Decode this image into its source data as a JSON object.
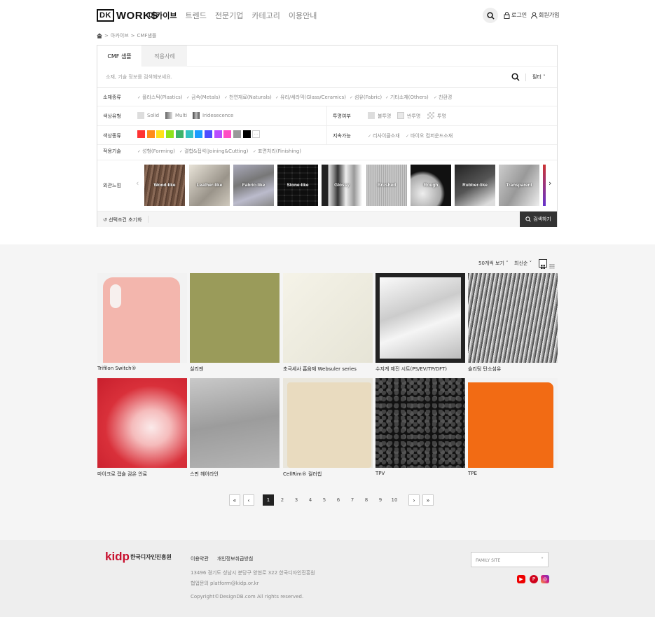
{
  "header": {
    "logo_mark": "DK",
    "logo_text": "WORKS",
    "nav": [
      "아카이브",
      "트렌드",
      "전문기업",
      "카테고리",
      "이용안내"
    ],
    "login": "로그인",
    "signup": "회원가입"
  },
  "breadcrumb": {
    "level1": "아카이브",
    "level2": "CMF샘플"
  },
  "tabs": [
    "CMF 샘플",
    "적용사례"
  ],
  "search": {
    "placeholder": "소재, 기술 정보를 검색해보세요.",
    "filter_label": "필터"
  },
  "filters": {
    "material": {
      "label": "소재종류",
      "options": [
        "플라스틱(Plastics)",
        "금속(Metals)",
        "천연재료(Naturals)",
        "유리/세라믹(Glass/Ceramics)",
        "섬유(Fabric)",
        "기타소재(Others)",
        "친환경"
      ]
    },
    "color_type": {
      "label": "색상유형",
      "options": [
        "Solid",
        "Multi",
        "Iridesecence"
      ]
    },
    "transparency": {
      "label": "투명여부",
      "options": [
        "불투명",
        "반투명",
        "투명"
      ]
    },
    "color_kind": {
      "label": "색상종류",
      "colors": [
        "#ff3333",
        "#ff8c1a",
        "#ffe11a",
        "#8fe31a",
        "#3db36b",
        "#33c2c2",
        "#1a9cff",
        "#4d4dff",
        "#b84dff",
        "#ff4dc4",
        "#999999",
        "#000000"
      ],
      "more": "..."
    },
    "sustainability": {
      "label": "지속가능",
      "options": [
        "리사이클소재",
        "바이오 컴퍼운드소재"
      ]
    },
    "technique": {
      "label": "적용기술",
      "options": [
        "성형(Forming)",
        "결합&접석(Joining&Cutting)",
        "표면처리(Finishing)"
      ]
    },
    "texture": {
      "label": "외관느낌",
      "items": [
        "Wood-like",
        "Leather-like",
        "Fabric-like",
        "Stone-like",
        "Glossy",
        "Brushed",
        "Rough",
        "Rubber-like",
        "Transparent"
      ]
    },
    "reset": "선택조건 초기화",
    "search_button": "검색하기"
  },
  "list": {
    "per_page": "50개씩 보기",
    "sort": "최신순"
  },
  "products": [
    {
      "name": "Trifilon Switch®"
    },
    {
      "name": "실리젠"
    },
    {
      "name": "초극세사 흡음재 Websuler series"
    },
    {
      "name": "수지계 제진 시트(PS/EV/TP/DFT)"
    },
    {
      "name": "슬리팅 탄소섬유"
    },
    {
      "name": "마이크로 캡슐 감온 안료"
    },
    {
      "name": "스핀 헤어라인"
    },
    {
      "name": "CellRim® 컬러칩"
    },
    {
      "name": "TPV"
    },
    {
      "name": "TPE"
    }
  ],
  "pagination": {
    "first": "«",
    "prev": "‹",
    "pages": [
      "1",
      "2",
      "3",
      "4",
      "5",
      "6",
      "7",
      "8",
      "9",
      "10"
    ],
    "next": "›",
    "last": "»"
  },
  "footer": {
    "logo": "kidp",
    "org": "한국디자인진흥원",
    "links": [
      "이용약관",
      "개인정보취급방침"
    ],
    "address": "13496 경기도 성남시 분당구 양현로 322 한국디자인진흥원",
    "contact": "협업문의 platform@kidp.or.kr",
    "copyright": "Copyright©DesignDB.com All rights reserved.",
    "family_site": "FAMILY SITE"
  }
}
